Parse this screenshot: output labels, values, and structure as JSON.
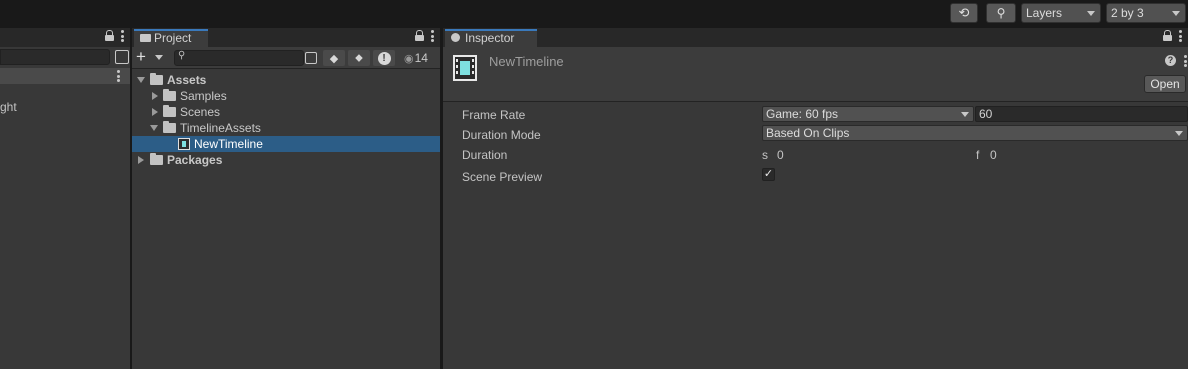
{
  "toolbar": {
    "history_icon": "history-icon",
    "search_icon": "search-icon",
    "layers_label": "Layers",
    "layout_label": "2 by 3"
  },
  "left_panel": {
    "partial_item": "ght"
  },
  "project_panel": {
    "tab_label": "Project",
    "add_label": "+",
    "search_placeholder": "",
    "hidden_count": "14",
    "tree": [
      {
        "label": "Assets",
        "expanded": true,
        "bold": true
      },
      {
        "label": "Samples",
        "expanded": false
      },
      {
        "label": "Scenes",
        "expanded": false
      },
      {
        "label": "TimelineAssets",
        "expanded": true
      },
      {
        "label": "NewTimeline",
        "selected": true
      },
      {
        "label": "Packages",
        "expanded": false,
        "bold": true
      }
    ]
  },
  "inspector": {
    "tab_label": "Inspector",
    "asset_name": "NewTimeline",
    "open_label": "Open",
    "help_label": "?",
    "properties": {
      "frame_rate": {
        "label": "Frame Rate",
        "option": "Game: 60 fps",
        "value": "60"
      },
      "duration_mode": {
        "label": "Duration Mode",
        "option": "Based On Clips"
      },
      "duration": {
        "label": "Duration",
        "s_label": "s",
        "s_value": "0",
        "f_label": "f",
        "f_value": "0"
      },
      "scene_preview": {
        "label": "Scene Preview",
        "checked": true,
        "check_glyph": "✓"
      }
    }
  },
  "colors": {
    "selection": "#2c5d87",
    "tab_accent": "#3a79bb",
    "timeline_icon": "#7ee0e0"
  }
}
